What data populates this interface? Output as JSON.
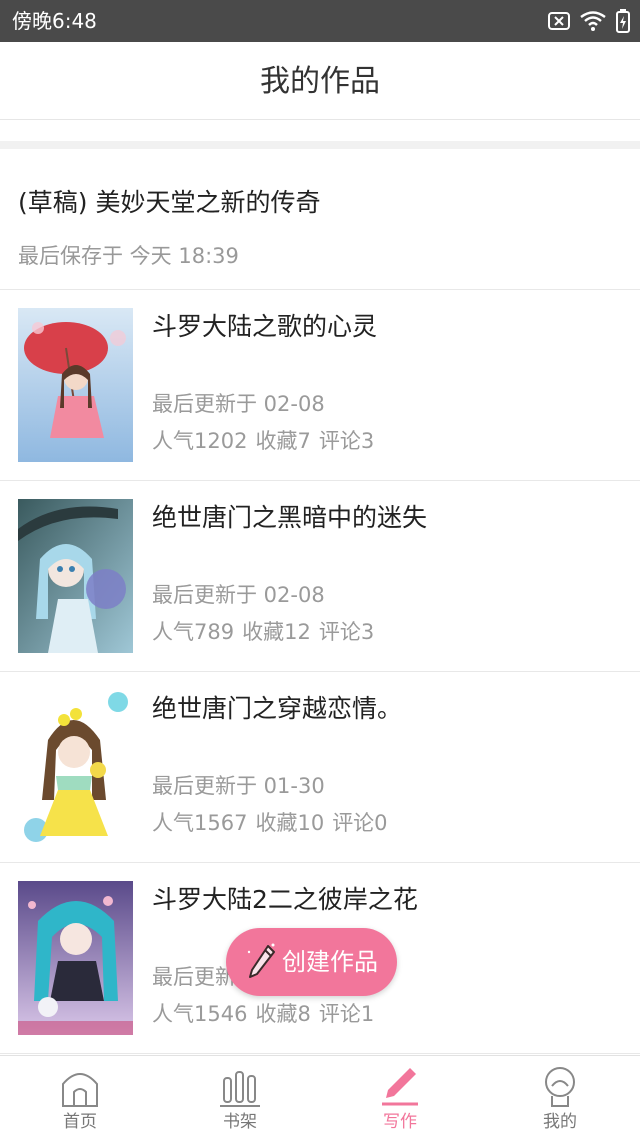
{
  "status_bar": {
    "time": "傍晚6:48",
    "icons": [
      "sim-x-icon",
      "wifi-icon",
      "battery-icon"
    ]
  },
  "header": {
    "title": "我的作品"
  },
  "draft": {
    "title": "(草稿) 美妙天堂之新的传奇",
    "saved": "最后保存于 今天 18:39"
  },
  "works": [
    {
      "title": "斗罗大陆之歌的心灵",
      "updated": "最后更新于 02-08",
      "popularity": "人气1202",
      "favorites": "收藏7",
      "comments": "评论3"
    },
    {
      "title": "绝世唐门之黑暗中的迷失",
      "updated": "最后更新于 02-08",
      "popularity": "人气789",
      "favorites": "收藏12",
      "comments": "评论3"
    },
    {
      "title": "绝世唐门之穿越恋情。",
      "updated": "最后更新于 01-30",
      "popularity": "人气1567",
      "favorites": "收藏10",
      "comments": "评论0"
    },
    {
      "title": "斗罗大陆2二之彼岸之花",
      "updated": "最后更新于",
      "popularity": "人气1546",
      "favorites": "收藏8",
      "comments": "评论1"
    }
  ],
  "fab": {
    "label": "创建作品",
    "icon": "pencil-icon"
  },
  "bottom_nav": {
    "items": [
      {
        "label": "首页",
        "icon": "home-icon",
        "active": false
      },
      {
        "label": "书架",
        "icon": "bookshelf-icon",
        "active": false
      },
      {
        "label": "写作",
        "icon": "pencil-icon",
        "active": true
      },
      {
        "label": "我的",
        "icon": "profile-icon",
        "active": false
      }
    ]
  },
  "colors": {
    "accent": "#f2769b",
    "status_bar": "#4a4a4a",
    "secondary_text": "#999999"
  }
}
